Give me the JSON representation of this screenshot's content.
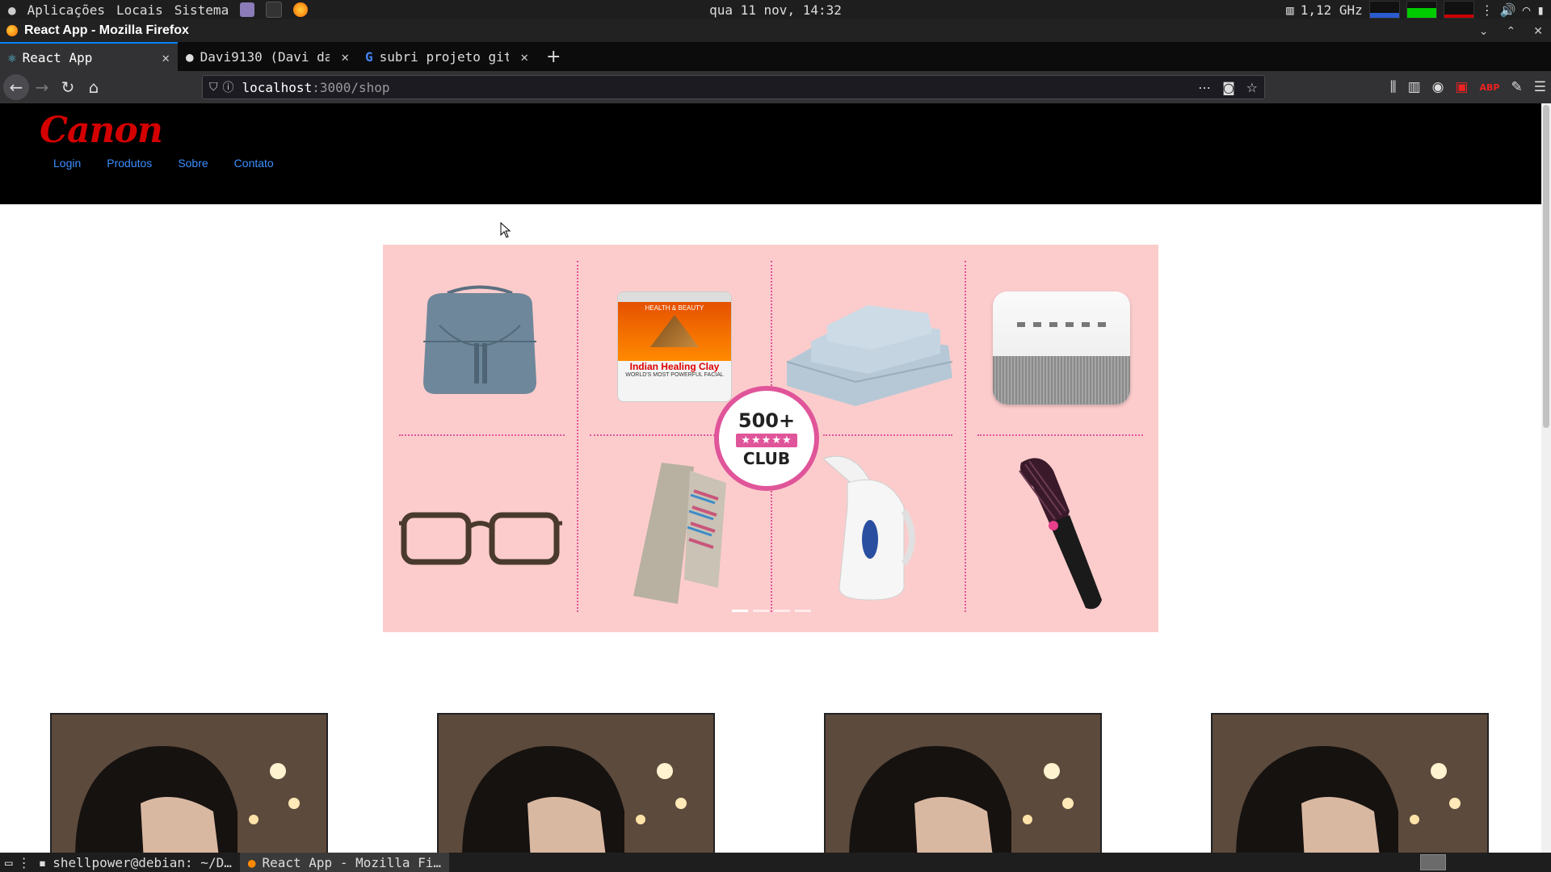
{
  "system_panel": {
    "menus": [
      "Aplicações",
      "Locais",
      "Sistema"
    ],
    "clock": "qua 11 nov, 14:32",
    "cpu_freq": "1,12 GHz"
  },
  "window": {
    "title": "React App - Mozilla Firefox"
  },
  "tabs": [
    {
      "label": "React App",
      "active": true
    },
    {
      "label": "Davi9130 (Davi da",
      "active": false
    },
    {
      "label": "subri projeto git",
      "active": false
    }
  ],
  "urlbar": {
    "host": "localhost",
    "path": ":3000/shop"
  },
  "site": {
    "brand": "Canon",
    "menu": [
      "Login",
      "Produtos",
      "Sobre",
      "Contato"
    ]
  },
  "banner": {
    "badge_top": "500+",
    "badge_stars": "★★★★★",
    "badge_bottom": "CLUB",
    "product_jar_brand": "HEALTH & BEAUTY",
    "product_jar_label": "Indian Healing Clay",
    "product_jar_sub": "WORLD'S MOST POWERFUL FACIAL"
  },
  "taskbar": {
    "tasks": [
      {
        "label": "shellpower@debian: ~/D…",
        "active": false
      },
      {
        "label": "React App - Mozilla Fi…",
        "active": true
      }
    ]
  }
}
